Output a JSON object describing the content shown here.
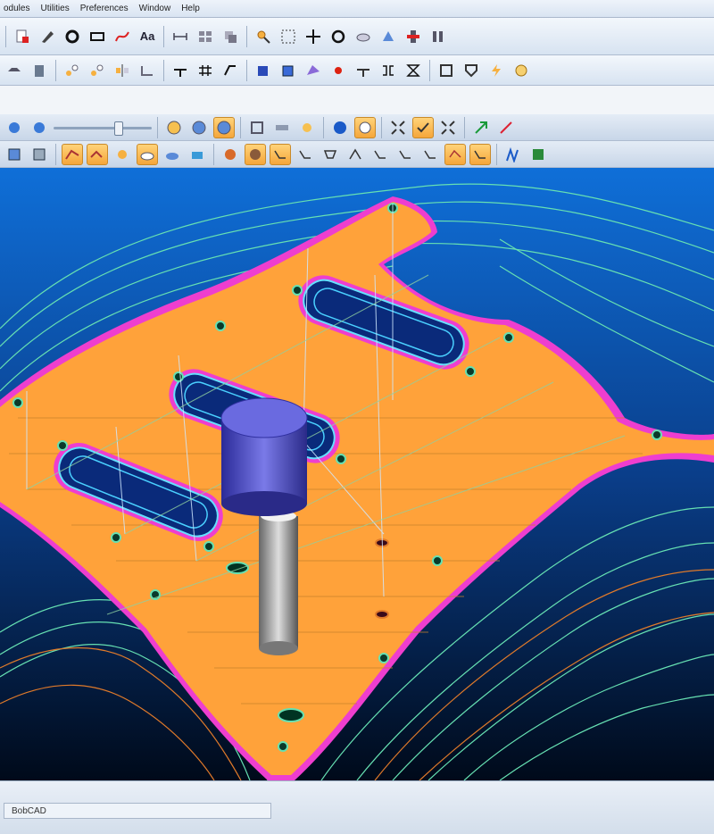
{
  "menubar": {
    "items": [
      "odules",
      "Utilities",
      "Preferences",
      "Window",
      "Help"
    ]
  },
  "toolbar": {
    "text_tool_label": "Aa"
  },
  "viewport": {
    "colors": {
      "background_top": "#0f6fd8",
      "background_bottom": "#000a1a",
      "part_fill": "#ffa23a",
      "part_edge": "#ee3ecf",
      "toolpath_green": "#66e0b2",
      "toolpath_orange": "#e07a2a",
      "pocket_fill": "#0a2a7a",
      "tool_holder": "#3a3aa8"
    }
  },
  "statusbar": {
    "app_name": "BobCAD"
  }
}
